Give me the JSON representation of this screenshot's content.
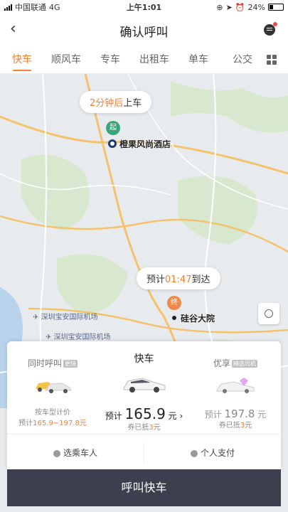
{
  "status_bar": {
    "carrier": "中国联通",
    "network": "4G",
    "time": "上午1:01",
    "battery": "24%"
  },
  "header": {
    "title": "确认呼叫"
  },
  "tabs": [
    {
      "label": "快车",
      "active": true
    },
    {
      "label": "顺风车",
      "active": false
    },
    {
      "label": "专车",
      "active": false
    },
    {
      "label": "出租车",
      "active": false
    },
    {
      "label": "单车",
      "active": false
    },
    {
      "label": "公交",
      "active": false
    }
  ],
  "map": {
    "pickup_bubble": {
      "highlight": "2分钟后",
      "text": "上车"
    },
    "pickup_pin": "起",
    "pickup_place": "橙果风尚酒店",
    "arrival_bubble": {
      "prefix": "预计",
      "time": "01:47",
      "suffix": "到达"
    },
    "dest_pin": "终",
    "dest_place": "硅谷大院",
    "airport_1": "深圳宝安国际机场",
    "airport_2": "深圳宝安国际机场"
  },
  "options": [
    {
      "title": "同时呼叫",
      "badge": "更快",
      "line1": "按车型计价",
      "line2_prefix": "预计",
      "line2_range": "165.9~197.8元"
    },
    {
      "title": "快车",
      "price_prefix": "预计",
      "price": "165.9",
      "price_unit": "元 ›",
      "coupon_prefix": "券已抵",
      "coupon_value": "3",
      "coupon_unit": "元"
    },
    {
      "title": "优享",
      "badge": "精选司机",
      "price_prefix": "预计",
      "price": "197.8",
      "price_unit": "元",
      "coupon_prefix": "券已抵",
      "coupon_value": "3",
      "coupon_unit": "元"
    }
  ],
  "footer_options": {
    "passenger": "选乘车人",
    "payment": "个人支付"
  },
  "cta": "呼叫快车",
  "colors": {
    "accent": "#f57f33",
    "cta_bg": "#3d3f4f",
    "pickup_pin": "#3aa57a"
  }
}
